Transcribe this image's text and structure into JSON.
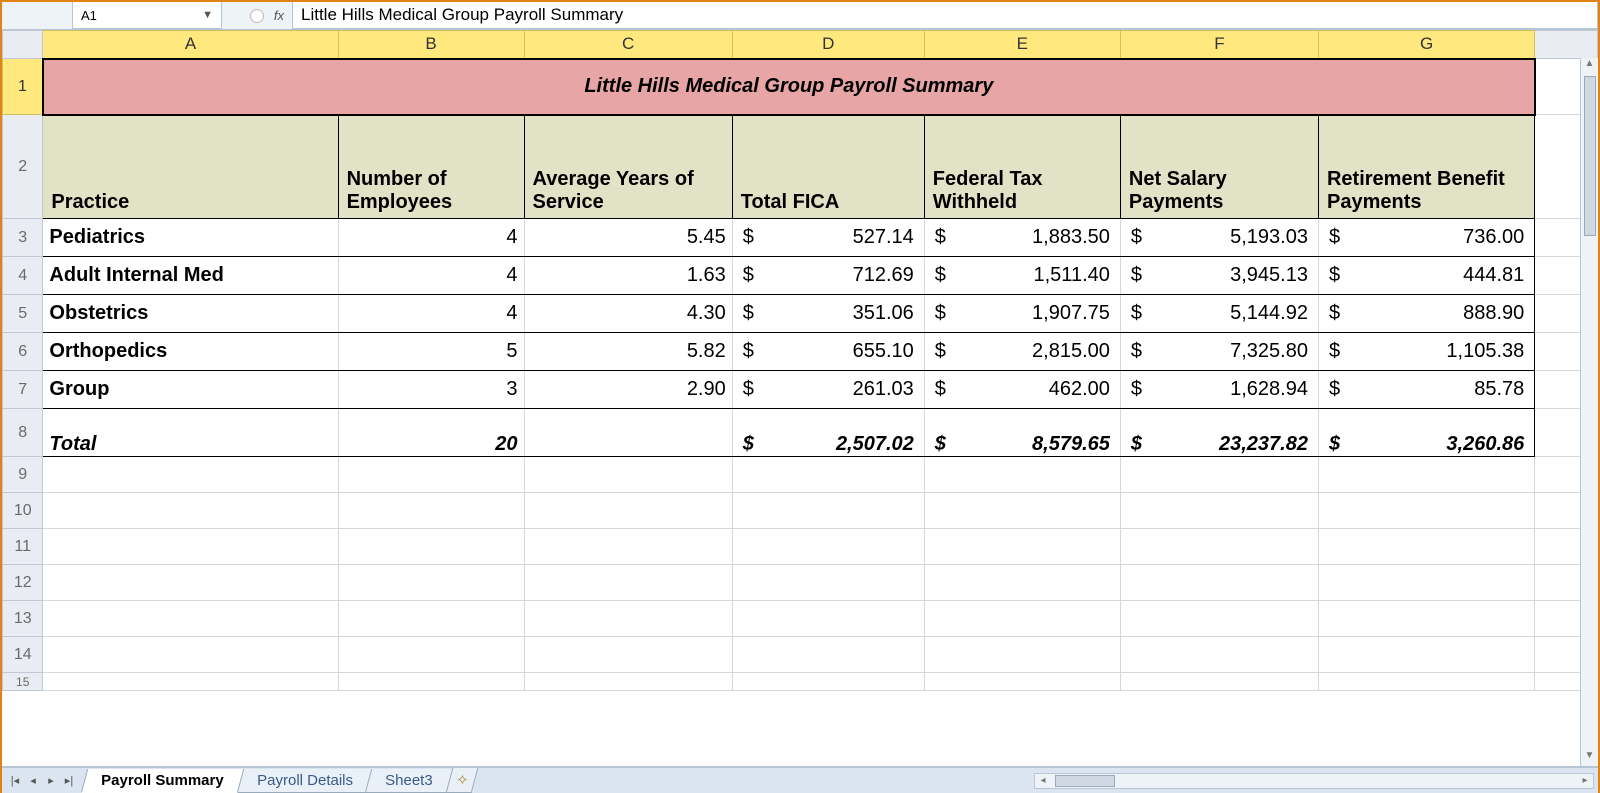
{
  "nameBox": "A1",
  "formulaBar": "Little Hills Medical Group Payroll Summary",
  "columns": [
    "A",
    "B",
    "C",
    "D",
    "E",
    "F",
    "G"
  ],
  "rowNumbers": [
    1,
    2,
    3,
    4,
    5,
    6,
    7,
    8,
    9,
    10,
    11,
    12,
    13,
    14,
    15
  ],
  "title": "Little Hills Medical Group Payroll Summary",
  "headers": {
    "A": "Practice",
    "B": "Number of Employees",
    "C": "Average Years of Service",
    "D": "Total FICA",
    "E": "Federal Tax Withheld",
    "F": "Net Salary Payments",
    "G": "Retirement Benefit Payments"
  },
  "rows": [
    {
      "practice": "Pediatrics",
      "num": "4",
      "yrs": "5.45",
      "fica": "527.14",
      "fed": "1,883.50",
      "net": "5,193.03",
      "ret": "736.00"
    },
    {
      "practice": "Adult Internal Med",
      "num": "4",
      "yrs": "1.63",
      "fica": "712.69",
      "fed": "1,511.40",
      "net": "3,945.13",
      "ret": "444.81"
    },
    {
      "practice": "Obstetrics",
      "num": "4",
      "yrs": "4.30",
      "fica": "351.06",
      "fed": "1,907.75",
      "net": "5,144.92",
      "ret": "888.90"
    },
    {
      "practice": "Orthopedics",
      "num": "5",
      "yrs": "5.82",
      "fica": "655.10",
      "fed": "2,815.00",
      "net": "7,325.80",
      "ret": "1,105.38"
    },
    {
      "practice": "Group",
      "num": "3",
      "yrs": "2.90",
      "fica": "261.03",
      "fed": "462.00",
      "net": "1,628.94",
      "ret": "85.78"
    }
  ],
  "total": {
    "label": "Total",
    "num": "20",
    "fica": "2,507.02",
    "fed": "8,579.65",
    "net": "23,237.82",
    "ret": "3,260.86"
  },
  "currencySymbol": "$",
  "tabs": [
    {
      "label": "Payroll Summary",
      "active": true
    },
    {
      "label": "Payroll Details",
      "active": false
    },
    {
      "label": "Sheet3",
      "active": false
    }
  ],
  "fxLabel": "fx"
}
